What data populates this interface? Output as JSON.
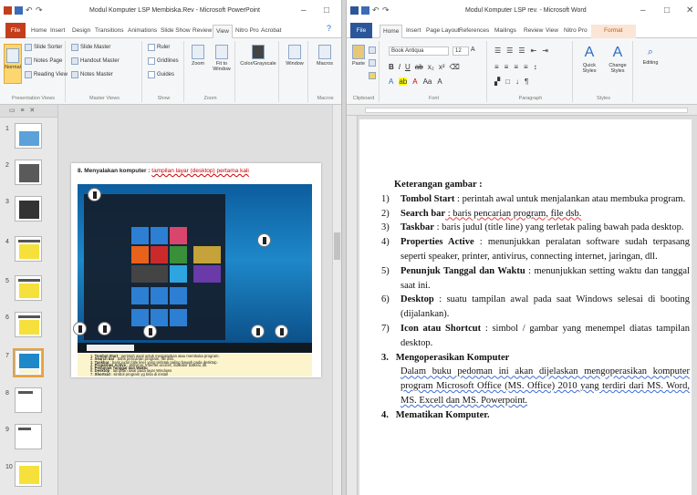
{
  "ppt": {
    "title": "Modul Komputer LSP Membiska.Rev - Microsoft PowerPoint",
    "tabs": [
      "File",
      "Home",
      "Insert",
      "Design",
      "Transitions",
      "Animations",
      "Slide Show",
      "Review",
      "View",
      "Nitro Pro",
      "Acrobat"
    ],
    "active_tab": "View",
    "ribbon": {
      "presentation_views": {
        "label": "Presentation Views",
        "normal": "Normal",
        "slide_sorter": "Slide Sorter",
        "notes_page": "Notes Page",
        "reading_view": "Reading View"
      },
      "master_views": {
        "label": "Master Views",
        "slide_master": "Slide Master",
        "handout_master": "Handout Master",
        "notes_master": "Notes Master"
      },
      "show": {
        "label": "Show",
        "ruler": "Ruler",
        "gridlines": "Gridlines",
        "guides": "Guides"
      },
      "zoom": {
        "label": "Zoom",
        "zoom": "Zoom",
        "fit": "Fit to Window"
      },
      "color": {
        "label": "Color/Grayscale"
      },
      "window": {
        "label": "Window"
      },
      "macros": {
        "label": "Macros",
        "button": "Macros"
      }
    },
    "thumbnails": [
      "1",
      "2",
      "3",
      "4",
      "5",
      "6",
      "7",
      "8",
      "9",
      "10"
    ],
    "selected_slide": "7",
    "slide": {
      "title_prefix": "8.  Menyalakan komputer : ",
      "title_link": "tampilan layar (desktop) pertama kali",
      "caption": [
        {
          "n": "1.",
          "b": "Tombol Start",
          "t": " : perintah awal untuk menjalankan atau membuka program."
        },
        {
          "n": "2.",
          "b": "Search bar",
          "t": " : baris pencarian program, file dsb."
        },
        {
          "n": "3.",
          "b": "Taskbar",
          "t": " : baris judul (title line) yang terletak paling bawah pada desktop."
        },
        {
          "n": "4.",
          "b": "Properties Active",
          "t": " : antivirus, internet access, indikator baterai, dll."
        },
        {
          "n": "5.",
          "b": "Penunjuk Tanggal dan Waktu",
          "t": ""
        },
        {
          "n": "6.",
          "b": "Desktop",
          "t": " : tampilan awal pada layar Windows"
        },
        {
          "n": "7.",
          "b": "Shortcut",
          "t": " : simbol program yg bisa di install"
        }
      ]
    }
  },
  "word": {
    "title": "Modul Komputer LSP  rev. - Microsoft Word",
    "tabs": [
      "File",
      "Home",
      "Insert",
      "Page Layout",
      "References",
      "Mailings",
      "Review",
      "View",
      "Nitro Pro",
      "Format"
    ],
    "active_tab": "Home",
    "ribbon": {
      "font_name": "Book Antiqua",
      "font_size": "12",
      "groups": {
        "clipboard": "Clipboard",
        "font": "Font",
        "paragraph": "Paragraph",
        "styles": "Styles",
        "editing": "Editing"
      },
      "paste": "Paste",
      "quick_styles": "Quick Styles",
      "change_styles": "Change Styles",
      "editing": "Editing"
    },
    "doc": {
      "heading": "Keterangan gambar :",
      "items": [
        {
          "n": "1)",
          "b": "Tombol Start",
          "t": " : perintah awal untuk menjalankan atau membuka program."
        },
        {
          "n": "2)",
          "b": "Search bar",
          "t": " : baris pencarian program, file dsb."
        },
        {
          "n": "3)",
          "b": "Taskbar",
          "t": " : baris judul (title line) yang terletak paling bawah pada desktop."
        },
        {
          "n": "4)",
          "b": "Properties Active",
          "t": " : menunjukkan peralatan software sudah terpasang seperti speaker, printer, antivirus, connecting internet, jaringan, dll."
        },
        {
          "n": "5)",
          "b": "Penunjuk Tanggal dan Waktu",
          "t": " : menunjukkan setting waktu dan tanggal saat ini."
        },
        {
          "n": "6)",
          "b": "Desktop",
          "t": " : suatu tampilan awal pada saat Windows selesai di booting (dijalankan)."
        },
        {
          "n": "7)",
          "b": "Icon atau Shortcut",
          "t": " : simbol / gambar yang menempel diatas tampilan desktop."
        }
      ],
      "section3_num": "3.",
      "section3_title": "Mengoperasikan Komputer",
      "section3_body": "Dalam buku pedoman ini akan dijelaskan mengoperasikan komputer program Microsoft Office (MS. Office) 2010 yang terdiri dari MS. Word, MS. Excell dan MS. Powerpoint.",
      "section4_num": "4.",
      "section4_title": "Mematikan Komputer."
    }
  },
  "colors": {
    "ppt_accent": "#c43e1c",
    "word_accent": "#2b579a",
    "highlight": "#fbf4cc"
  }
}
